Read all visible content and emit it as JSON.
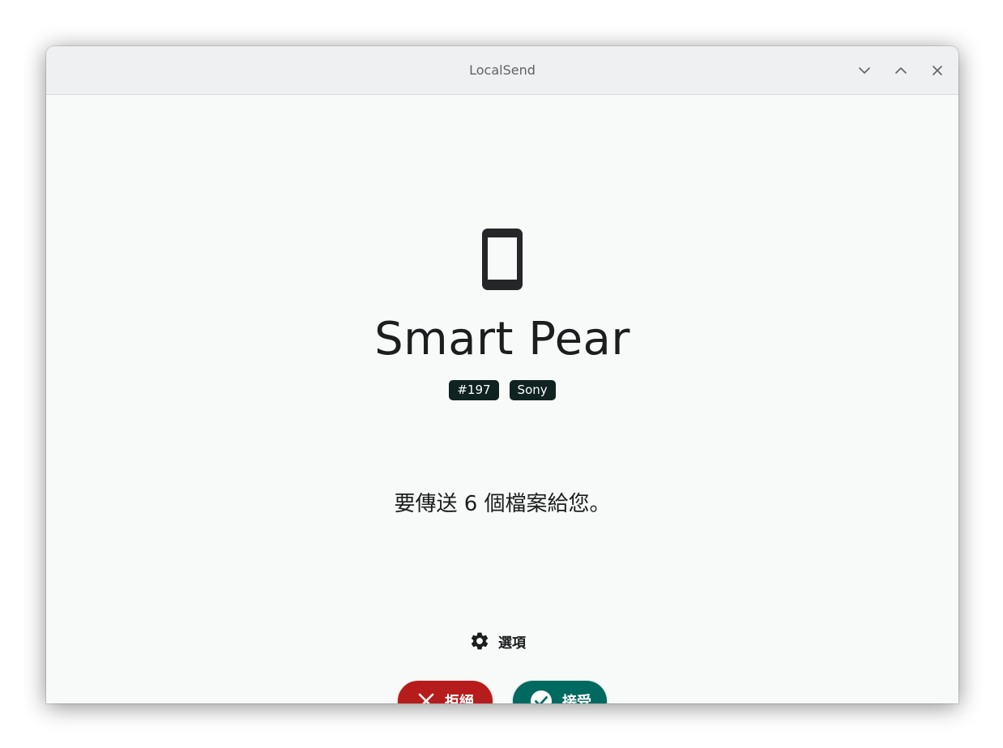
{
  "window": {
    "title": "LocalSend"
  },
  "device": {
    "icon": "smartphone-icon",
    "name": "Smart Pear",
    "badges": [
      "#197",
      "Sony"
    ]
  },
  "message": "要傳送 6 個檔案給您。",
  "options": {
    "icon": "gear-icon",
    "label": "選項"
  },
  "actions": {
    "reject_label": "拒絕",
    "accept_label": "接受"
  },
  "colors": {
    "reject": "#b71c1c",
    "accept": "#006a60",
    "badge": "#0f2321",
    "background": "#f8faf9"
  }
}
